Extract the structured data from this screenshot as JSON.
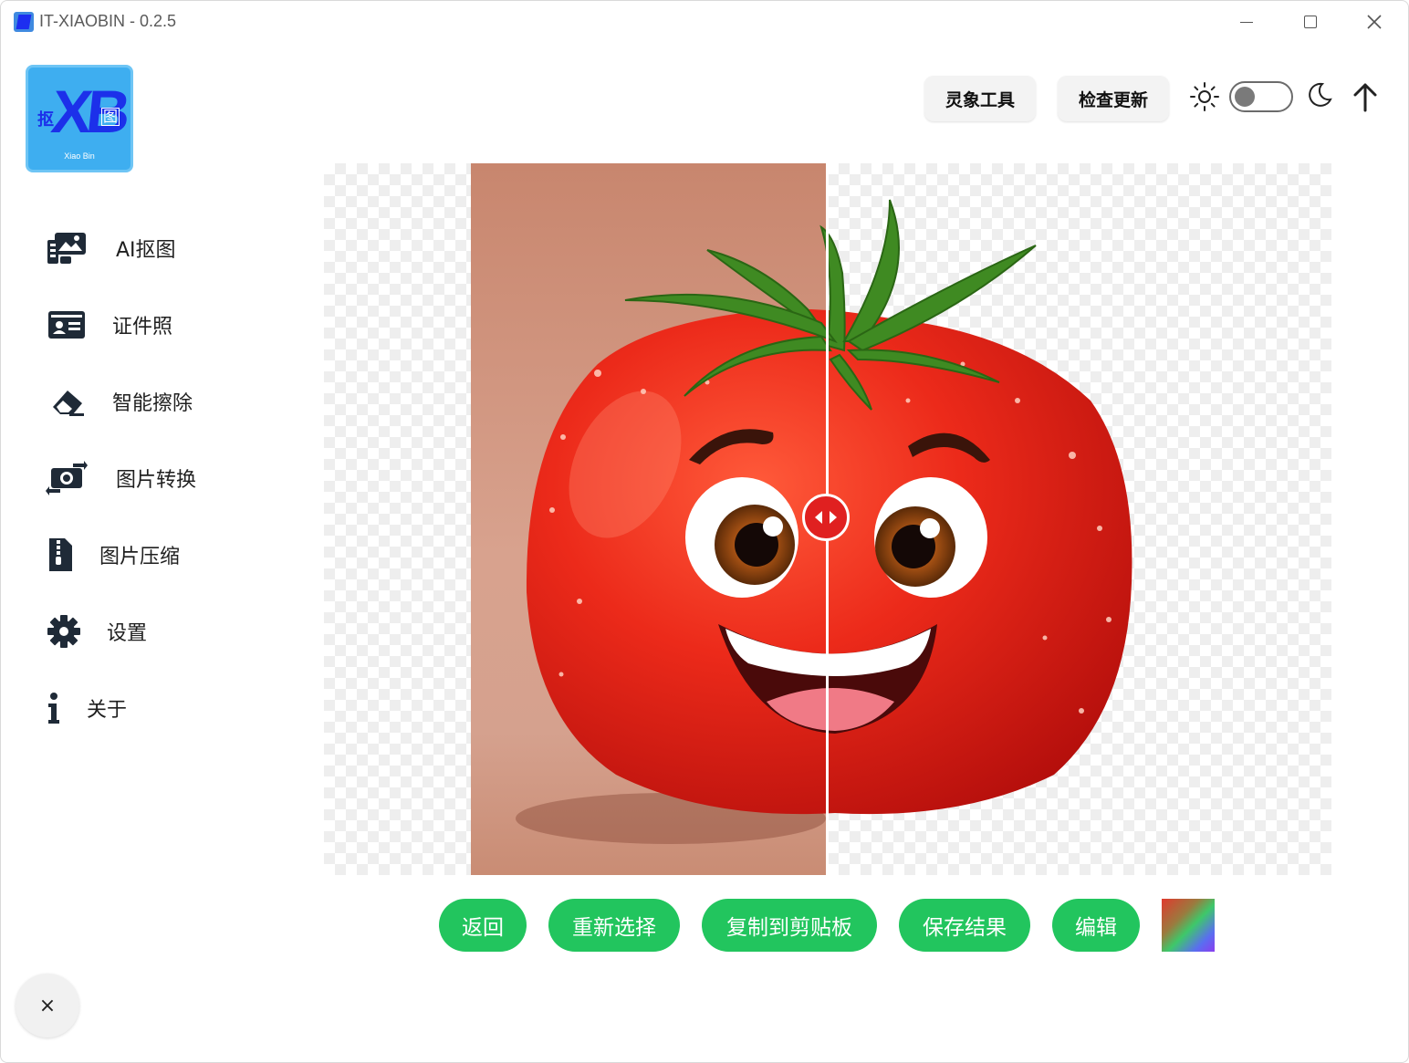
{
  "window": {
    "title": "IT-XIAOBIN - 0.2.5"
  },
  "logo": {
    "main": "XB",
    "left_char": "抠",
    "right_char": "图",
    "subtitle": "Xiao Bin"
  },
  "sidebar": {
    "items": [
      {
        "label": "AI抠图",
        "icon": "image-cutout-icon"
      },
      {
        "label": "证件照",
        "icon": "id-card-icon"
      },
      {
        "label": "智能擦除",
        "icon": "eraser-icon"
      },
      {
        "label": "图片转换",
        "icon": "image-convert-icon"
      },
      {
        "label": "图片压缩",
        "icon": "file-zip-icon"
      },
      {
        "label": "设置",
        "icon": "gear-icon"
      },
      {
        "label": "关于",
        "icon": "info-icon"
      }
    ],
    "close_label": "×"
  },
  "header": {
    "tools_label": "灵象工具",
    "update_label": "检查更新",
    "theme_toggle_on": false
  },
  "compare": {
    "split": 0.5
  },
  "actions": {
    "back": "返回",
    "reselect": "重新选择",
    "copy": "复制到剪贴板",
    "save": "保存结果",
    "edit": "编辑"
  },
  "colors": {
    "accent": "#22c55e",
    "tomato": "#e8231a",
    "handle": "#e02020"
  }
}
